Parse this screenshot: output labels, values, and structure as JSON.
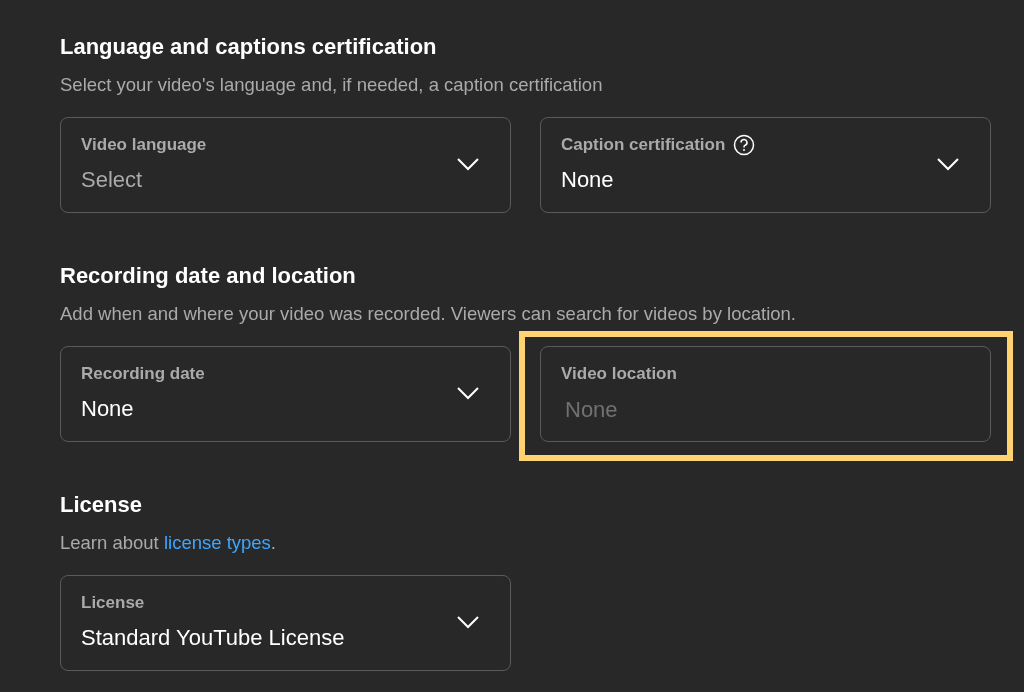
{
  "sections": [
    {
      "heading": "Language and captions certification",
      "description": [
        {
          "kind": "text",
          "text": "Select your video's language and, if needed, a caption certification"
        }
      ],
      "fields": [
        {
          "kind": "dropdown",
          "label": "Video language",
          "placeholder": "Select",
          "help": false,
          "highlighted": false
        },
        {
          "kind": "dropdown",
          "label": "Caption certification",
          "value": "None",
          "help": true,
          "highlighted": false
        }
      ]
    },
    {
      "heading": "Recording date and location",
      "description": [
        {
          "kind": "text",
          "text": "Add when and where your video was recorded. Viewers can search for videos by location."
        }
      ],
      "fields": [
        {
          "kind": "dropdown",
          "label": "Recording date",
          "value": "None",
          "help": false,
          "highlighted": false
        },
        {
          "kind": "text",
          "label": "Video location",
          "placeholder": "None",
          "help": false,
          "highlighted": true
        }
      ]
    },
    {
      "heading": "License",
      "description": [
        {
          "kind": "text",
          "text": "Learn about "
        },
        {
          "kind": "link",
          "text": "license types"
        },
        {
          "kind": "text",
          "text": "."
        }
      ],
      "fields": [
        {
          "kind": "dropdown",
          "label": "License",
          "value": "Standard YouTube License",
          "help": false,
          "highlighted": false
        }
      ]
    }
  ]
}
